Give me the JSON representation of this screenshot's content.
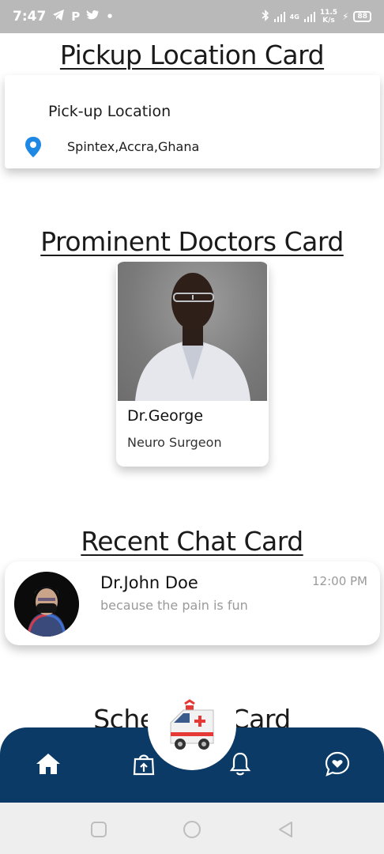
{
  "status_bar": {
    "time": "7:47",
    "left_icons": [
      "telegram-icon",
      "p-icon",
      "twitter-icon",
      "dot-icon"
    ],
    "network_type": "4G",
    "speed_value": "11.5",
    "speed_unit": "K/s",
    "battery": "88"
  },
  "sections": {
    "pickup_title": "Pickup Location Card",
    "doctors_title": "Prominent Doctors Card",
    "chat_title": "Recent Chat Card",
    "schedule_title": "Schedules Card"
  },
  "pickup": {
    "label": "Pick-up Location",
    "value": "Spintex,Accra,Ghana",
    "icon": "location-pin-icon",
    "icon_color": "#1e88e5"
  },
  "doctor": {
    "name": "Dr.George",
    "role": "Neuro Surgeon"
  },
  "chat": {
    "name": "Dr.John Doe",
    "message": "because the pain is fun",
    "time": "12:00 PM"
  },
  "bottom_nav": {
    "background": "#0b3a66",
    "items": [
      "home-icon",
      "shopping-bag-upload-icon",
      "ambulance-icon",
      "bell-icon",
      "chat-heart-icon"
    ]
  },
  "system_nav": [
    "recents-square-icon",
    "home-circle-icon",
    "back-triangle-icon"
  ]
}
